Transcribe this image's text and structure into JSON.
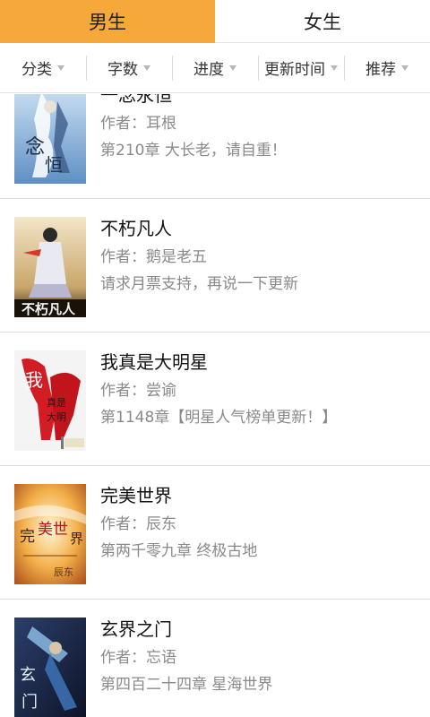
{
  "tabs": {
    "male": "男生",
    "female": "女生"
  },
  "filters": [
    "分类",
    "字数",
    "进度",
    "更新时间",
    "推荐"
  ],
  "author_prefix": "作者：",
  "books": [
    {
      "title": "一念永恒",
      "author": "耳根",
      "latest": "第210章 大长老，请自重！",
      "cover_icon": "book-cover-image"
    },
    {
      "title": "不朽凡人",
      "author": "鹅是老五",
      "latest": "请求月票支持，再说一下更新",
      "cover_icon": "book-cover-image"
    },
    {
      "title": "我真是大明星",
      "author": "尝谕",
      "latest": "第1148章【明星人气榜单更新！】",
      "cover_icon": "book-cover-image"
    },
    {
      "title": "完美世界",
      "author": "辰东",
      "latest": "第两千零九章 终极古地",
      "cover_icon": "book-cover-image"
    },
    {
      "title": "玄界之门",
      "author": "忘语",
      "latest": "第四百二十四章 星海世界",
      "cover_icon": "book-cover-image"
    }
  ],
  "colors": {
    "active_tab": "#f7a83a",
    "meta_text": "#8a8a8a",
    "divider": "#dcdcdc"
  }
}
